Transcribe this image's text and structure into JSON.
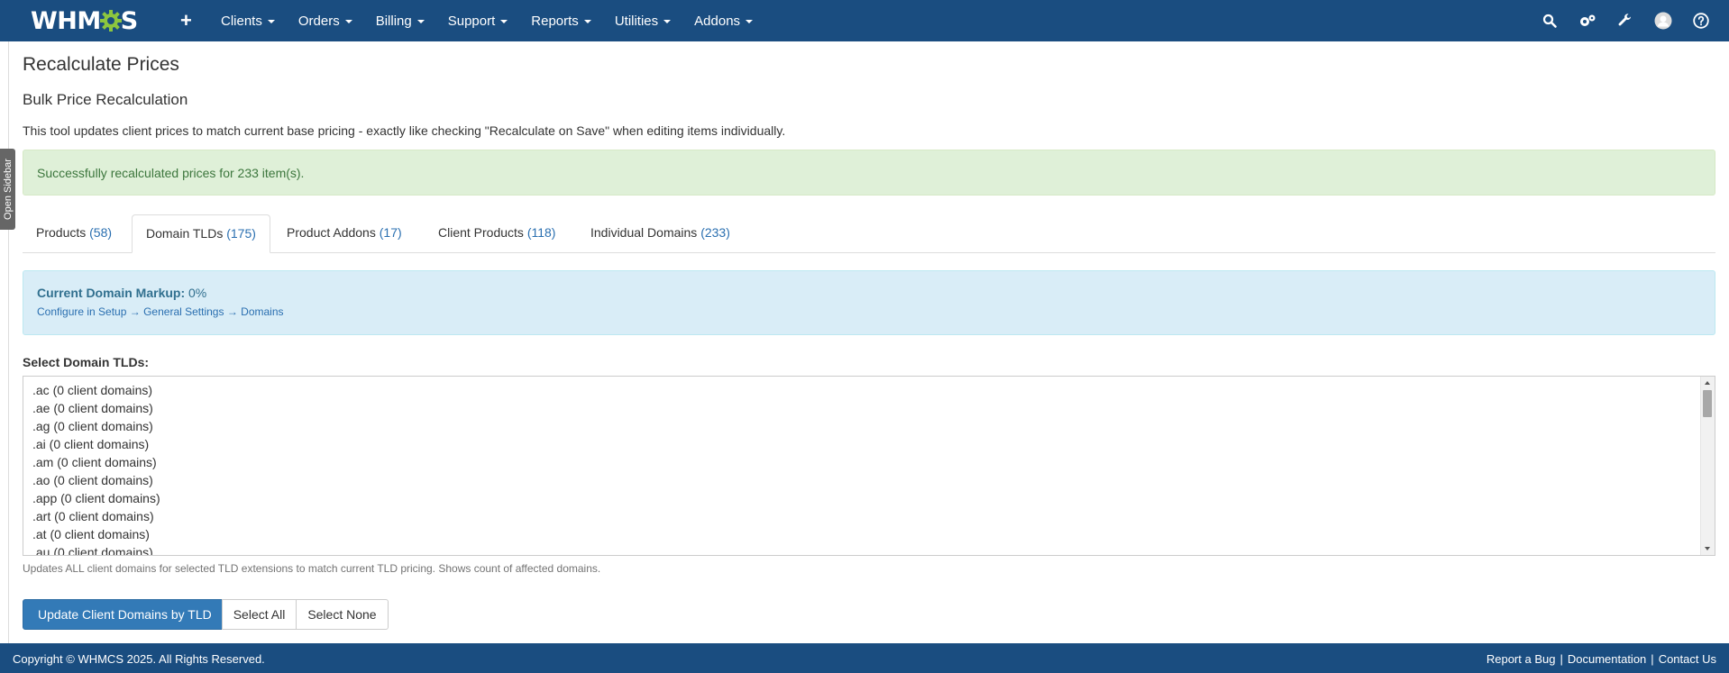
{
  "nav": {
    "logo_left": "WHM",
    "logo_right": "S",
    "plus": "+",
    "menu": [
      "Clients",
      "Orders",
      "Billing",
      "Support",
      "Reports",
      "Utilities",
      "Addons"
    ]
  },
  "sidebar": {
    "toggle_label": "Open Sidebar"
  },
  "page": {
    "title": "Recalculate Prices",
    "section_title": "Bulk Price Recalculation",
    "intro": "This tool updates client prices to match current base pricing - exactly like checking \"Recalculate on Save\" when editing items individually.",
    "success_message": "Successfully recalculated prices for 233 item(s)."
  },
  "tabs": [
    {
      "label": "Products",
      "count": "(58)"
    },
    {
      "label": "Domain TLDs",
      "count": "(175)"
    },
    {
      "label": "Product Addons",
      "count": "(17)"
    },
    {
      "label": "Client Products",
      "count": "(118)"
    },
    {
      "label": "Individual Domains",
      "count": "(233)"
    }
  ],
  "active_tab": "Domain TLDs",
  "markup": {
    "label": "Current Domain Markup:",
    "value": "0%",
    "link_prefix": "Configure in Setup",
    "arrow": "→",
    "link_general": "General Settings",
    "link_domains": "Domains"
  },
  "tld_select": {
    "label": "Select Domain TLDs:",
    "options": [
      ".ac (0 client domains)",
      ".ae (0 client domains)",
      ".ag (0 client domains)",
      ".ai (0 client domains)",
      ".am (0 client domains)",
      ".ao (0 client domains)",
      ".app (0 client domains)",
      ".art (0 client domains)",
      ".at (0 client domains)",
      ".au (0 client domains)"
    ],
    "help": "Updates ALL client domains for selected TLD extensions to match current TLD pricing. Shows count of affected domains."
  },
  "buttons": {
    "update": "Update Client Domains by TLD",
    "select_all": "Select All",
    "select_none": "Select None"
  },
  "footer": {
    "copyright": "Copyright © WHMCS 2025. All Rights Reserved.",
    "report_bug": "Report a Bug",
    "documentation": "Documentation",
    "contact": "Contact Us",
    "separator": "|"
  },
  "colors": {
    "nav_bg": "#1a4d80",
    "success_bg": "#dff0d8",
    "info_bg": "#d9edf7",
    "primary": "#337ab7",
    "logo_gear": "#8cc63f"
  },
  "icons": [
    "search-icon",
    "cogs-icon",
    "wrench-icon",
    "avatar-icon",
    "help-icon"
  ]
}
